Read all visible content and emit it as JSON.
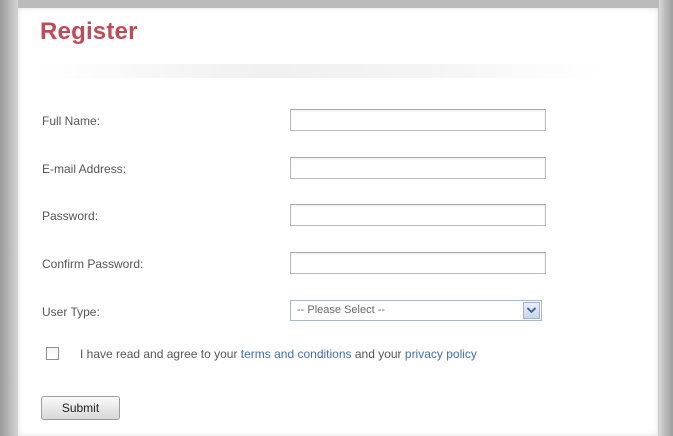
{
  "page": {
    "title": "Register",
    "accent_color": "#c24a55",
    "link_color": "#3f6fb0"
  },
  "form": {
    "fields": [
      {
        "label": "Full Name:",
        "value": "",
        "type": "text"
      },
      {
        "label": "E-mail Address:",
        "value": "",
        "type": "email"
      },
      {
        "label": "Password:",
        "value": "",
        "type": "password"
      },
      {
        "label": "Confirm Password:",
        "value": "",
        "type": "password"
      }
    ],
    "user_type": {
      "label": "User Type:",
      "selected": "-- Please Select --",
      "icon": "chevron-down-icon"
    },
    "agreement": {
      "checked": false,
      "text_before": "I have read and agree to your ",
      "terms_link": "terms and conditions",
      "text_middle": " and your ",
      "privacy_link": "privacy policy"
    },
    "submit_label": "Submit"
  }
}
